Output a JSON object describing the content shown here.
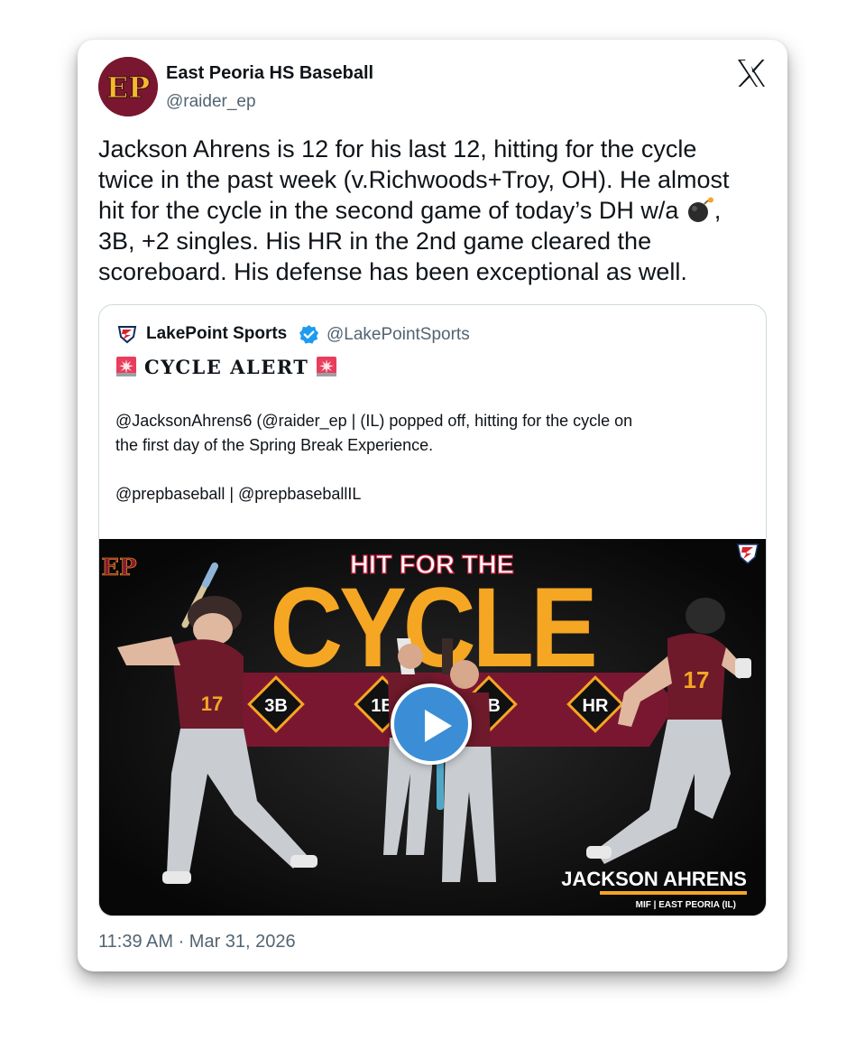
{
  "tweet": {
    "author_name": "East Peoria HS Baseball",
    "author_handle": "@raider_ep",
    "avatar_text": "EP",
    "text_lines": [
      "Jackson Ahrens is 12 for his last 12, hitting for the cycle",
      "twice in the past week (v.Richwoods+Troy, OH). He almost",
      "hit for the cycle in the second game of today’s DH w/a",
      "3B, +2 singles. His HR in the 2nd game cleared the",
      "scoreboard. His defense has been exceptional as well."
    ],
    "line3_suffix": ",",
    "timestamp": "11:39 AM · Mar 31, 2026"
  },
  "quote": {
    "name": "LakePoint Sports",
    "handle": "@LakePointSports",
    "alert": "CYCLE ALERT",
    "body_line1": "@JacksonAhrens6 (@raider_ep | (IL) popped off, hitting for the cycle on",
    "body_line2": "the first day of the Spring Break Experience.",
    "body_line3": "@prepbaseball | @prepbaseballIL"
  },
  "graphic": {
    "top_text": "HIT FOR THE",
    "big_text": "CYCLE",
    "badges": [
      "3B",
      "1B",
      "2B",
      "HR"
    ],
    "player_name": "JACKSON AHRENS",
    "player_sub": "MIF | EAST PEORIA (IL)",
    "corner_logo": "EP",
    "jersey_number": "17"
  },
  "icons": {
    "x_logo": "x-logo-icon",
    "verified": "verified-badge-icon",
    "siren": "rotating-light-icon",
    "bomb": "bomb-icon",
    "play": "play-icon"
  },
  "colors": {
    "maroon": "#7a1730",
    "gold": "#f5a623",
    "verified_blue": "#1d9bf0",
    "play_blue": "#3b8ed6",
    "muted_text": "#536471"
  }
}
